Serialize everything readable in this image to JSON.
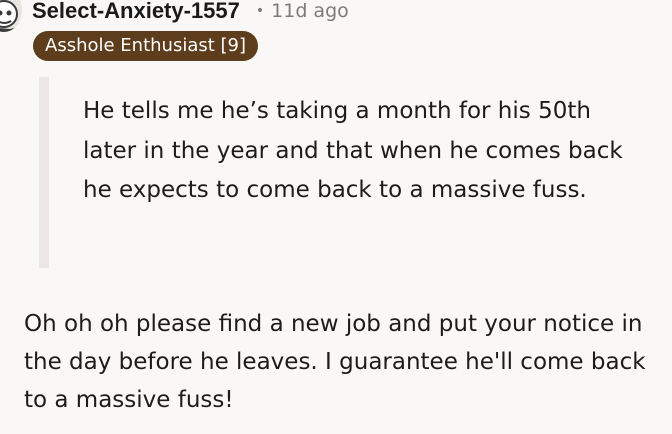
{
  "comment": {
    "author": "Select-Anxiety-1557",
    "separator": "•",
    "timestamp": "11d ago",
    "flair": "Asshole Enthusiast [9]",
    "quote": "He tells me he’s taking a month for his 50th later in the year and that when he comes back he expects to come back to a massive fuss.",
    "body": "Oh oh oh please find a new job and put your notice in the day before he leaves. I guarantee he'll come back to a massive fuss!"
  },
  "icons": {
    "avatar": "user-avatar-icon"
  },
  "colors": {
    "background": "#faf8f6",
    "flair_background": "#5d3d1c",
    "flair_text": "#ffffff",
    "meta_text": "#7c7c7c",
    "quote_bar": "#ece6e4",
    "text": "#1c1c1c"
  }
}
